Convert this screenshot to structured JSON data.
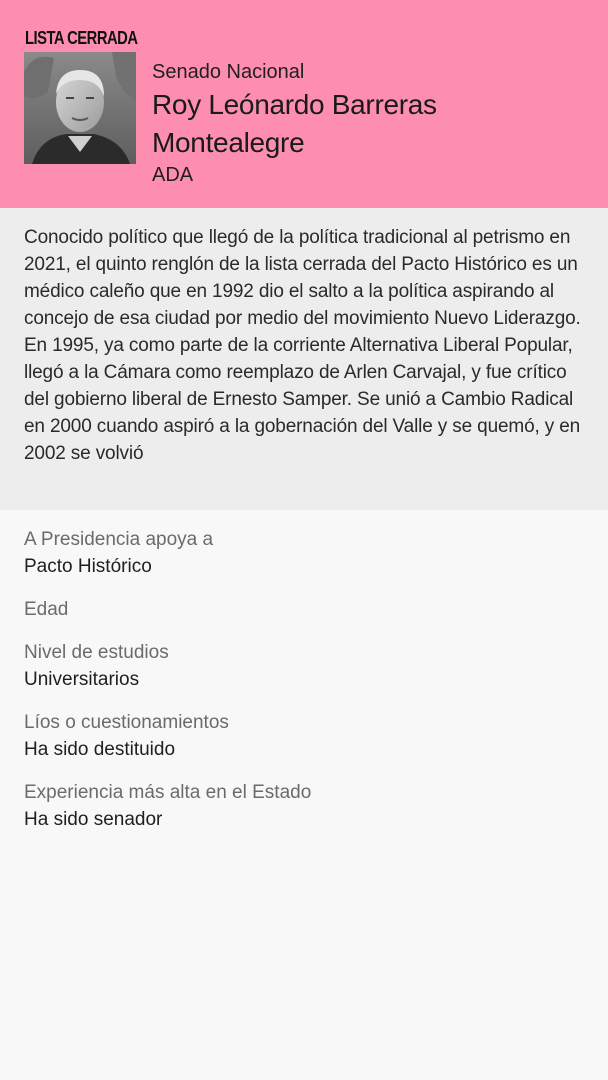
{
  "header": {
    "list_type": "LISTA CERRADA",
    "chamber": "Senado Nacional",
    "candidate_name": "Roy Leónardo Barreras Montealegre",
    "party": "ADA",
    "background_color": "#fd8eaf"
  },
  "bio": {
    "text": "Conocido político que llegó de la política tradicional al petrismo en 2021, el quinto renglón de la lista cerrada del Pacto Histórico es un médico caleño que en 1992 dio el salto a la política aspirando al concejo de esa ciudad por medio del movimiento Nuevo Liderazgo. En 1995, ya como parte de la corriente Alternativa Liberal Popular, llegó a la Cámara como reemplazo de Arlen Carvajal, y fue crítico del gobierno liberal de Ernesto Samper. Se unió a Cambio Radical en 2000 cuando aspiró a la gobernación del Valle y se quemó, y en 2002 se volvió"
  },
  "facts": [
    {
      "label": "A Presidencia apoya a",
      "value": "Pacto Histórico"
    },
    {
      "label": "Edad",
      "value": ""
    },
    {
      "label": "Nivel de estudios",
      "value": "Universitarios"
    },
    {
      "label": "Líos o cuestionamientos",
      "value": "Ha sido destituido"
    },
    {
      "label": "Experiencia más alta en el Estado",
      "value": "Ha sido senador"
    }
  ]
}
